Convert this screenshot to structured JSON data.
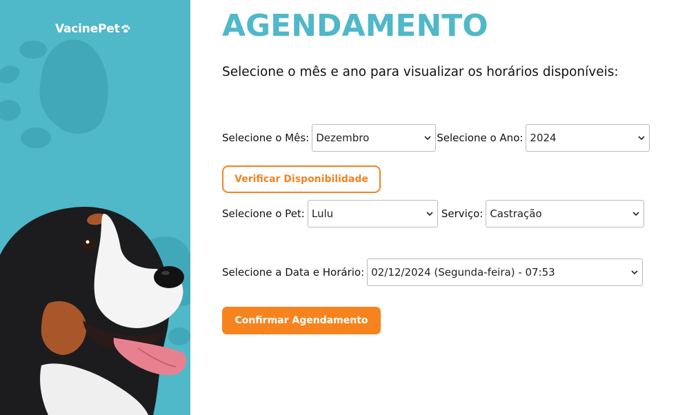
{
  "brand": {
    "name": "VacinePet",
    "icon": "paw-icon"
  },
  "page": {
    "title": "AGENDAMENTO",
    "subtitle": "Selecione o mês e ano para visualizar os horários disponíveis:"
  },
  "filters": {
    "month_label": "Selecione o Mês:",
    "month_value": "Dezembro",
    "year_label": "Selecione o Ano:",
    "year_value": "2024",
    "check_button": "Verificar Disponibilidade"
  },
  "booking": {
    "pet_label": "Selecione o Pet:",
    "pet_value": "Lulu",
    "service_label": "Serviço:",
    "service_value": "Castração",
    "datetime_label": "Selecione a Data e Horário:",
    "datetime_value": "02/12/2024 (Segunda-feira) - 07:53",
    "confirm_button": "Confirmar Agendamento"
  },
  "colors": {
    "accent": "#4fb8c9",
    "action": "#f7831f"
  },
  "icons": {
    "select_arrow": "chevron-down-icon",
    "decor_paw": "paw-print-icon",
    "dog": "dog-illustration"
  }
}
